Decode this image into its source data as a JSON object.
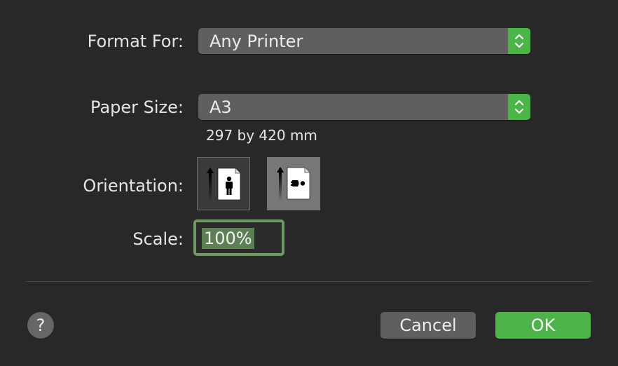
{
  "format_for": {
    "label": "Format For:",
    "value": "Any Printer"
  },
  "paper_size": {
    "label": "Paper Size:",
    "value": "A3",
    "dimensions": "297 by 420 mm"
  },
  "orientation": {
    "label": "Orientation:",
    "selected": "portrait",
    "options": [
      "portrait",
      "landscape"
    ]
  },
  "scale": {
    "label": "Scale:",
    "value": "100%"
  },
  "buttons": {
    "help": "?",
    "cancel": "Cancel",
    "ok": "OK"
  },
  "colors": {
    "background": "#282828",
    "accent": "#4cb448",
    "focus_ring": "#6e9a62"
  }
}
